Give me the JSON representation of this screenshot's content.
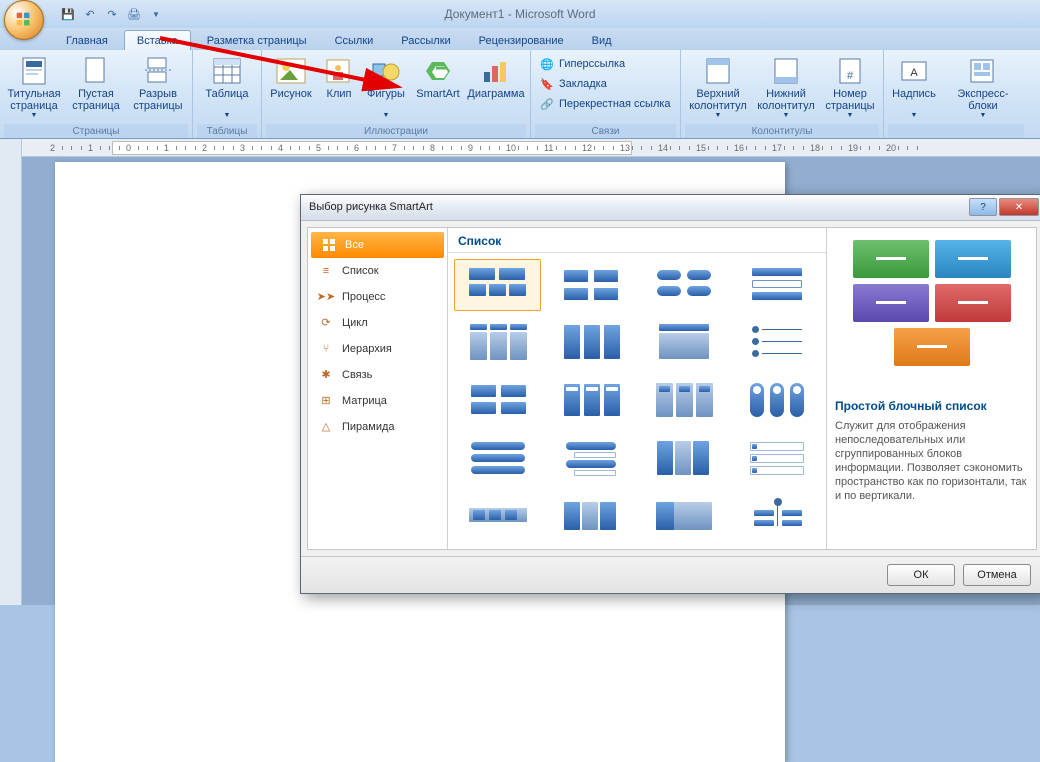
{
  "title": "Документ1 - Microsoft Word",
  "tabs": {
    "home": "Главная",
    "insert": "Вставка",
    "layout": "Разметка страницы",
    "refs": "Ссылки",
    "mail": "Рассылки",
    "review": "Рецензирование",
    "view": "Вид"
  },
  "ribbon": {
    "groups": {
      "pages": {
        "label": "Страницы",
        "cover": "Титульная страница",
        "blank": "Пустая страница",
        "break": "Разрыв страницы"
      },
      "tables": {
        "label": "Таблицы",
        "table": "Таблица"
      },
      "illustr": {
        "label": "Иллюстрации",
        "picture": "Рисунок",
        "clip": "Клип",
        "shapes": "Фигуры",
        "smartart": "SmartArt",
        "chart": "Диаграмма"
      },
      "links": {
        "label": "Связи",
        "hyperlink": "Гиперссылка",
        "bookmark": "Закладка",
        "crossref": "Перекрестная ссылка"
      },
      "headerfooter": {
        "label": "Колонтитулы",
        "header": "Верхний колонтитул",
        "footer": "Нижний колонтитул",
        "pagenum": "Номер страницы"
      },
      "text": {
        "caption": "Надпись",
        "quick": "Экспресс-блоки"
      }
    }
  },
  "dialog": {
    "title": "Выбор рисунка SmartArt",
    "categories": [
      {
        "key": "all",
        "label": "Все"
      },
      {
        "key": "list",
        "label": "Список"
      },
      {
        "key": "process",
        "label": "Процесс"
      },
      {
        "key": "cycle",
        "label": "Цикл"
      },
      {
        "key": "hierarchy",
        "label": "Иерархия"
      },
      {
        "key": "relationship",
        "label": "Связь"
      },
      {
        "key": "matrix",
        "label": "Матрица"
      },
      {
        "key": "pyramid",
        "label": "Пирамида"
      }
    ],
    "gallery_header": "Список",
    "preview": {
      "title": "Простой блочный список",
      "desc": "Служит для отображения непоследовательных или сгруппированных блоков информации. Позволяет сэкономить пространство как по горизонтали, так и по вертикали.",
      "colors": [
        "#58a858",
        "#3a9bd0",
        "#6a5ab8",
        "#d04a4a",
        "#e68a2e"
      ]
    },
    "ok": "ОК",
    "cancel": "Отмена"
  }
}
